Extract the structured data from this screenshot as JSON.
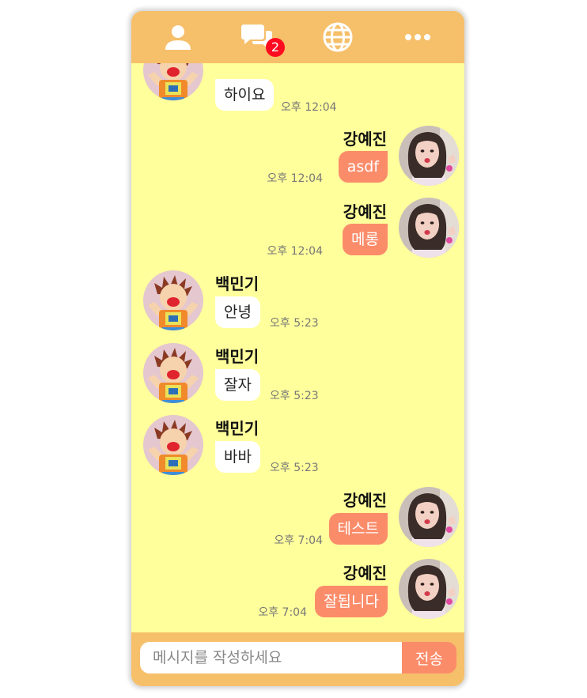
{
  "tabs": [
    {
      "name": "friends-tab",
      "icon": "person-icon"
    },
    {
      "name": "chats-tab",
      "icon": "chat-bubbles-icon",
      "badge": "2"
    },
    {
      "name": "browse-tab",
      "icon": "globe-icon"
    },
    {
      "name": "more-tab",
      "icon": "more-icon"
    }
  ],
  "users": {
    "left": {
      "name": "백민기"
    },
    "right": {
      "name": "강예진"
    }
  },
  "messages": [
    {
      "side": "left",
      "sender": "",
      "text": "하이요",
      "time": "오후 12:04"
    },
    {
      "side": "right",
      "sender": "강예진",
      "text": "asdf",
      "time": "오후 12:04"
    },
    {
      "side": "right",
      "sender": "강예진",
      "text": "메롱",
      "time": "오후 12:04"
    },
    {
      "side": "left",
      "sender": "백민기",
      "text": "안녕",
      "time": "오후 5:23"
    },
    {
      "side": "left",
      "sender": "백민기",
      "text": "잘자",
      "time": "오후 5:23"
    },
    {
      "side": "left",
      "sender": "백민기",
      "text": "바바",
      "time": "오후 5:23"
    },
    {
      "side": "right",
      "sender": "강예진",
      "text": "테스트",
      "time": "오후 7:04"
    },
    {
      "side": "right",
      "sender": "강예진",
      "text": "잘됩니다",
      "time": "오후 7:04"
    }
  ],
  "composer": {
    "placeholder": "메시지를 작성하세요",
    "send_label": "전송"
  },
  "colors": {
    "header": "#f6bf6a",
    "chat_background": "#ffff9c",
    "my_bubble": "#fb8c6a",
    "other_bubble": "#ffffff",
    "badge": "#ff0b1f"
  }
}
